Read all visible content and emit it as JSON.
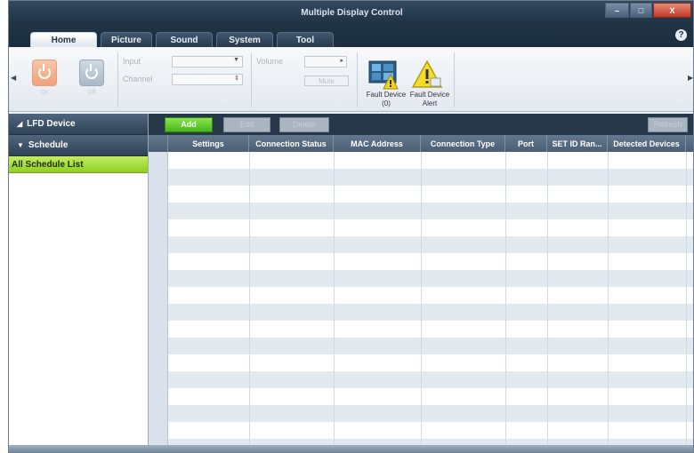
{
  "window": {
    "title": "Multiple Display Control"
  },
  "title_bar": {
    "minimize": "–",
    "maximize": "□",
    "close": "X",
    "help": "?"
  },
  "tabs": [
    {
      "label": "Home",
      "active": true
    },
    {
      "label": "Picture",
      "active": false
    },
    {
      "label": "Sound",
      "active": false
    },
    {
      "label": "System",
      "active": false
    },
    {
      "label": "Tool",
      "active": false
    }
  ],
  "ribbon": {
    "power_on_label": "On",
    "power_off_label": "Off",
    "input_label": "Input",
    "channel_label": "Channel",
    "volume_label": "Volume",
    "mute_label": "Mute",
    "fault_device_label": "Fault Device",
    "fault_device_count": "(0)",
    "fault_alert_label": "Fault Device",
    "fault_alert_sub": "Alert"
  },
  "sidebar": {
    "lfd_device": "LFD Device",
    "schedule": "Schedule",
    "all_schedule_list": "All Schedule List"
  },
  "toolbar": {
    "add": "Add",
    "edit": "Edit",
    "delete": "Delete",
    "refresh": "Refresh"
  },
  "grid": {
    "columns": [
      "Settings",
      "Connection Status",
      "MAC Address",
      "Connection Type",
      "Port",
      "SET ID Ran...",
      "Detected Devices"
    ],
    "rows": []
  },
  "colors": {
    "accent_green": "#8fd022",
    "title_bar": "#213547",
    "row_alt": "#e2eaf0"
  }
}
